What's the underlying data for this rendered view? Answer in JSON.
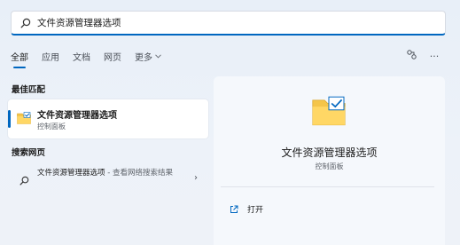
{
  "search": {
    "value": "文件资源管理器选项",
    "icon": "search-icon"
  },
  "tabs": [
    {
      "label": "全部",
      "active": true
    },
    {
      "label": "应用",
      "active": false
    },
    {
      "label": "文档",
      "active": false
    },
    {
      "label": "网页",
      "active": false
    },
    {
      "label": "更多",
      "active": false
    }
  ],
  "toolbar": {
    "share_icon": "share-icon",
    "more_label": "···"
  },
  "best_match": {
    "heading": "最佳匹配",
    "title": "文件资源管理器选项",
    "subtitle": "控制面板",
    "icon": "folder-check-icon"
  },
  "web_search": {
    "heading": "搜索网页",
    "query": "文件资源管理器选项",
    "suffix": " - 查看网络搜索结果",
    "arrow": "›"
  },
  "detail": {
    "title": "文件资源管理器选项",
    "subtitle": "控制面板",
    "action_label": "打开"
  },
  "colors": {
    "accent": "#0067c0",
    "folder": "#f4c54a"
  }
}
